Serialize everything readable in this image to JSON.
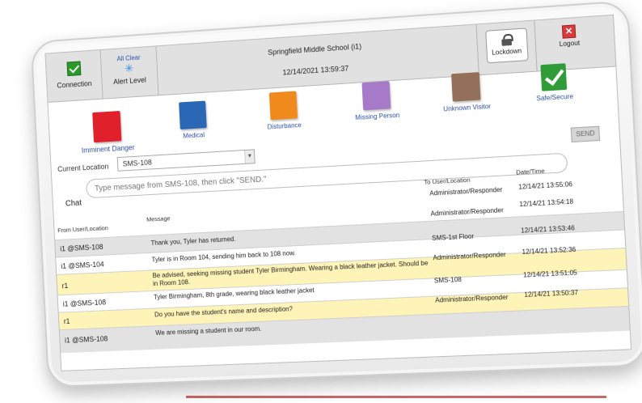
{
  "header": {
    "connection_label": "Connection",
    "alert_status": "All Clear",
    "alert_level_label": "Alert Level",
    "school_name": "Springfield Middle School (i1)",
    "datetime": "12/14/2021 13:59:37",
    "lockdown_label": "Lockdown",
    "logout_label": "Logout"
  },
  "alert_buttons": {
    "imminent_danger": "Imminent Danger",
    "medical": "Medical",
    "disturbance": "Disturbance",
    "missing_person": "Missing Person",
    "unknown_visitor": "Unknown Visitor",
    "safe_secure": "Safe/Secure"
  },
  "colors": {
    "imminent_danger": "#e0202b",
    "medical": "#2a68b5",
    "disturbance": "#f08a1c",
    "missing_person": "#a67ac8",
    "unknown_visitor": "#94705a",
    "safe_secure": "#2f9c37",
    "highlight_row": "#fff4b8"
  },
  "location": {
    "label": "Current Location",
    "value": "SMS-108"
  },
  "chat": {
    "label": "Chat",
    "placeholder": "Type message from SMS-108, then click \"SEND.\"",
    "send_label": "SEND"
  },
  "table": {
    "headers": {
      "from": "From User/Location",
      "message": "Message",
      "to": "To User/Location",
      "date": "Date/Time"
    },
    "rows": [
      {
        "from": "",
        "message": "",
        "to": "Administrator/Responder",
        "date": "12/14/21 13:55:06"
      },
      {
        "from": "i1 @SMS-108",
        "message": "Thank you, Tyler has returned.",
        "to": "Administrator/Responder",
        "date": "12/14/21 13:54:18"
      },
      {
        "from": "i1 @SMS-104",
        "message": "Tyler is in Room 104, sending him back to 108 now.",
        "to": "SMS-1st Floor",
        "date": "12/14/21 13:53:46"
      },
      {
        "from": "r1",
        "message": "Be advised, seeking missing student Tyler Birmingham. Wearing a black leather jacket. Should be in Room 108.",
        "to": "Administrator/Responder",
        "date": "12/14/21 13:52:36"
      },
      {
        "from": "i1 @SMS-108",
        "message": "Tyler Birmingham, 8th grade, wearing black leather jacket",
        "to": "SMS-108",
        "date": "12/14/21 13:51:05"
      },
      {
        "from": "r1",
        "message": "Do you have the student's name and description?",
        "to": "Administrator/Responder",
        "date": "12/14/21 13:50:37"
      },
      {
        "from": "i1 @SMS-108",
        "message": "We are missing a student in our room.",
        "to": "",
        "date": ""
      }
    ]
  }
}
